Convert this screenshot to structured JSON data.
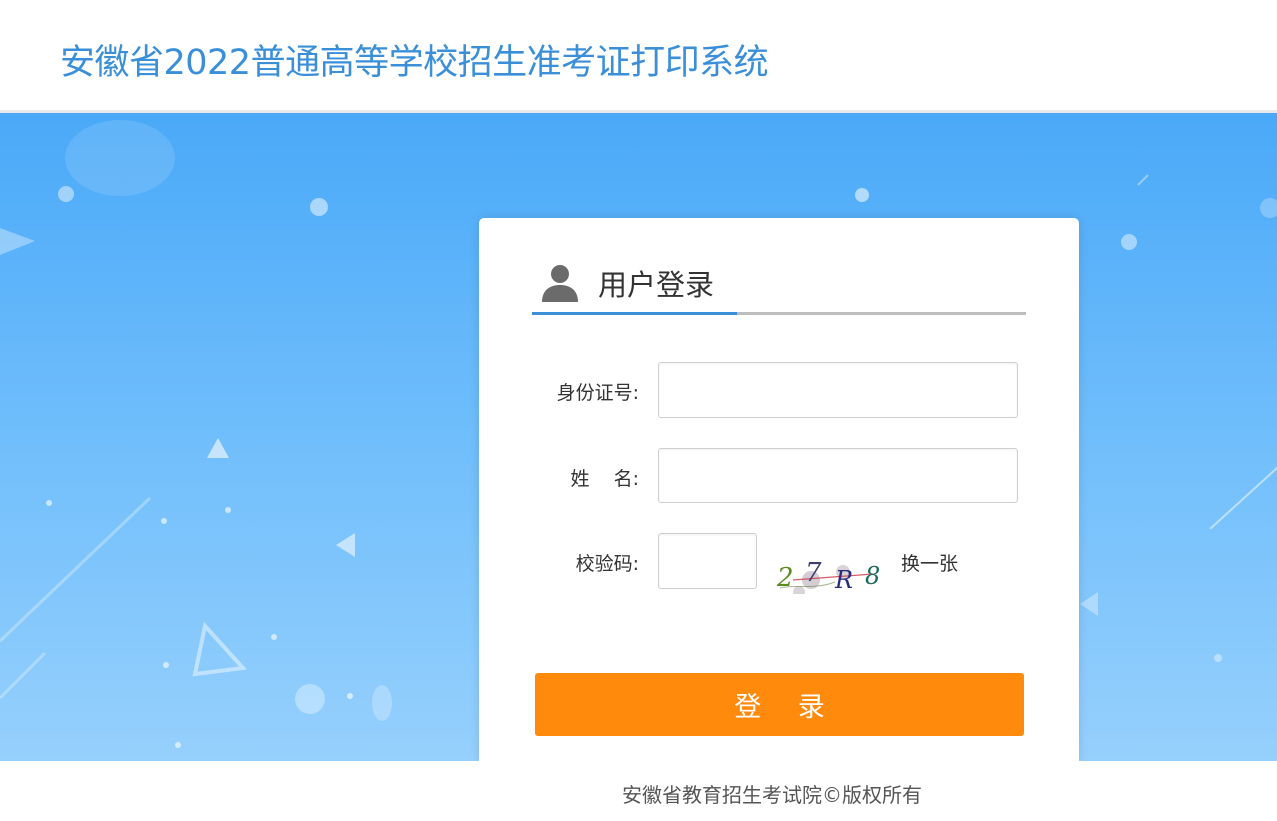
{
  "header": {
    "title": "安徽省2022普通高等学校招生准考证打印系统"
  },
  "login": {
    "title": "用户登录",
    "user_icon": "user-icon",
    "fields": {
      "id_label": "身份证号:",
      "id_value": "",
      "name_label": "姓    名:",
      "name_value": "",
      "captcha_label": "校验码:",
      "captcha_value": ""
    },
    "captcha_text": "27R8",
    "refresh_label": "换一张",
    "submit_label": "登 录"
  },
  "footer": {
    "copyright": "安徽省教育招生考试院©版权所有"
  },
  "colors": {
    "title_blue": "#3a8fd8",
    "button_orange": "#ff8a0c",
    "banner_top": "#4aa9f8",
    "banner_bottom": "#96d0fd"
  }
}
